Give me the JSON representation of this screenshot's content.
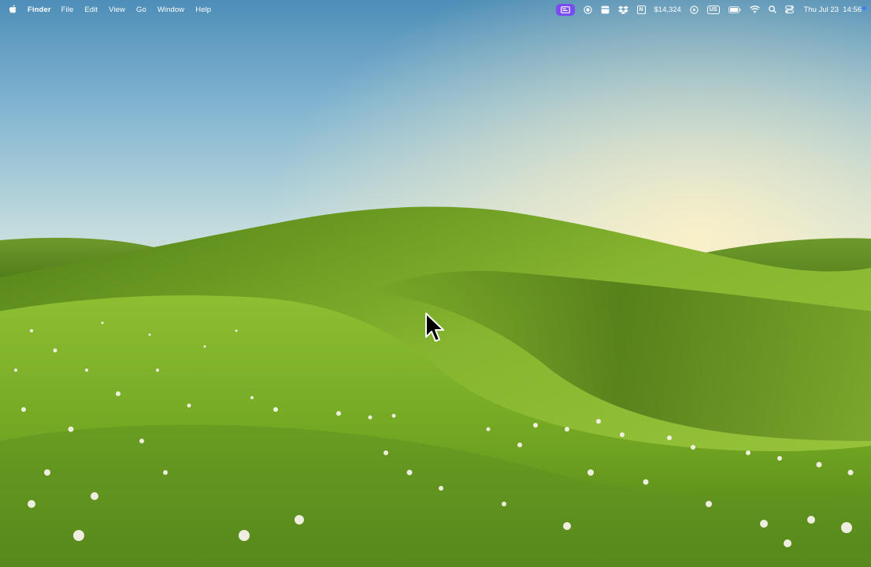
{
  "menubar": {
    "apple_icon": "apple-logo-icon",
    "app_name": "Finder",
    "menus": [
      "File",
      "Edit",
      "View",
      "Go",
      "Window",
      "Help"
    ],
    "status": {
      "stock_value": "$14,324",
      "input_source": "US",
      "datetime": "Thu Jul 23  14:56"
    }
  },
  "desktop": {
    "wallpaper": "rolling-green-hills-at-sunrise",
    "colors": {
      "sky_top": "#5f9cc2",
      "sky_mid": "#b9d6e0",
      "horizon": "#f4dfb1",
      "grass_light": "#8fc23a",
      "grass_dark": "#3f6d12",
      "accent_pill": "#7a4cf0"
    }
  },
  "cursor": {
    "type": "arrow-pointer-icon"
  }
}
